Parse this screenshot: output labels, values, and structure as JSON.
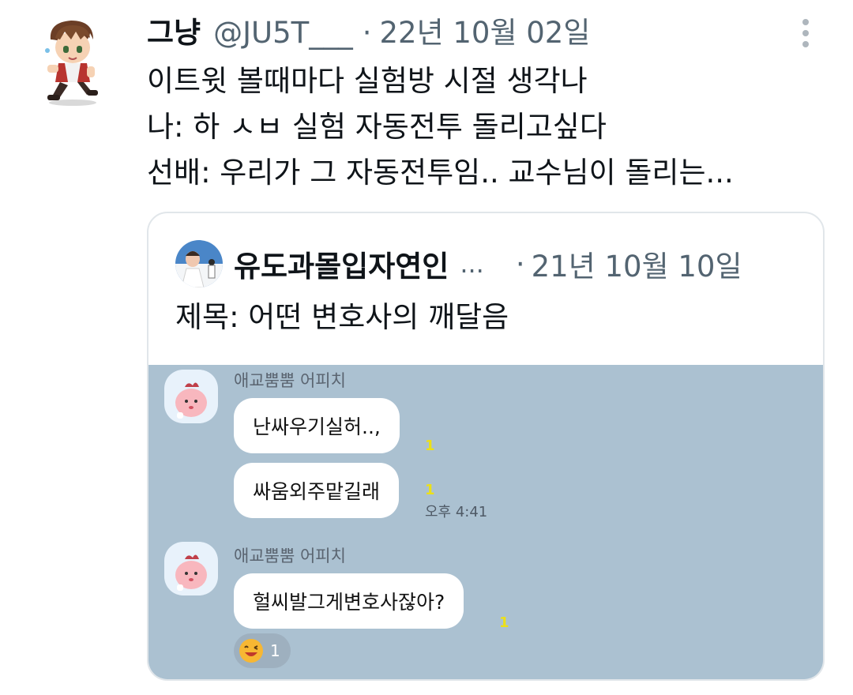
{
  "tweet": {
    "display_name": "그냥",
    "handle": "@JU5T___",
    "separator": "·",
    "date": "22년 10월 02일",
    "lines": [
      "이트윗 볼때마다 실험방 시절 생각나",
      "나: 하 ㅅㅂ 실험 자동전투 돌리고싶다",
      "선배: 우리가 그 자동전투임.. 교수님이 돌리는..."
    ]
  },
  "quote": {
    "display_name": "유도과몰입자연인",
    "ellipsis": "...",
    "separator": "·",
    "date": "21년 10월 10일",
    "text": "제목: 어떤 변호사의 깨달음"
  },
  "chat": {
    "groups": [
      {
        "sender": "애교뿜뿜 어피치",
        "messages": [
          {
            "text": "난싸우기실허..,",
            "unread": "1"
          },
          {
            "text": "싸움외주맡길래",
            "unread": "1",
            "time": "오후 4:41"
          }
        ]
      },
      {
        "sender": "애교뿜뿜 어피치",
        "messages": [
          {
            "text": "헐씨발그게변호사잖아?",
            "unread": "1"
          }
        ],
        "reaction": {
          "count": "1"
        }
      }
    ]
  },
  "colors": {
    "chat_bg": "#abc1d1",
    "unread": "#ece018",
    "meta_text": "#536471"
  }
}
